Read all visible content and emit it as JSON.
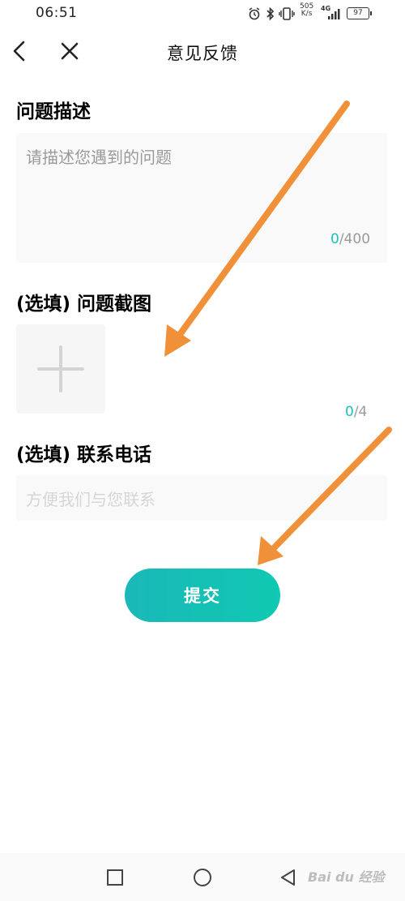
{
  "status_bar": {
    "time": "06:51",
    "net_speed_value": "505",
    "net_speed_unit": "K/s",
    "network": "4G",
    "battery": "97",
    "icons": [
      "alarm-icon",
      "bluetooth-icon",
      "vibrate-icon",
      "signal-icon",
      "battery-icon"
    ]
  },
  "header": {
    "title": "意见反馈",
    "icons": [
      "back-icon",
      "close-icon"
    ]
  },
  "description": {
    "title": "问题描述",
    "placeholder": "请描述您遇到的问题",
    "count_current": "0",
    "count_max": "/400"
  },
  "screenshot": {
    "title": "(选填) 问题截图",
    "count_current": "0",
    "count_max": "/4",
    "icon": "plus-icon"
  },
  "phone": {
    "title": "(选填) 联系电话",
    "placeholder": "方便我们与您联系"
  },
  "submit": {
    "label": "提交",
    "color_start": "#1ab8b8",
    "color_end": "#10c9b2"
  },
  "annotations": {
    "arrow_color": "#f0913a",
    "arrows": [
      "arrow-to-upload",
      "arrow-to-submit"
    ]
  },
  "system_nav": {
    "icons": [
      "recents-square-icon",
      "home-circle-icon",
      "back-triangle-icon"
    ]
  },
  "watermark": {
    "text": "Bai du 经验"
  }
}
